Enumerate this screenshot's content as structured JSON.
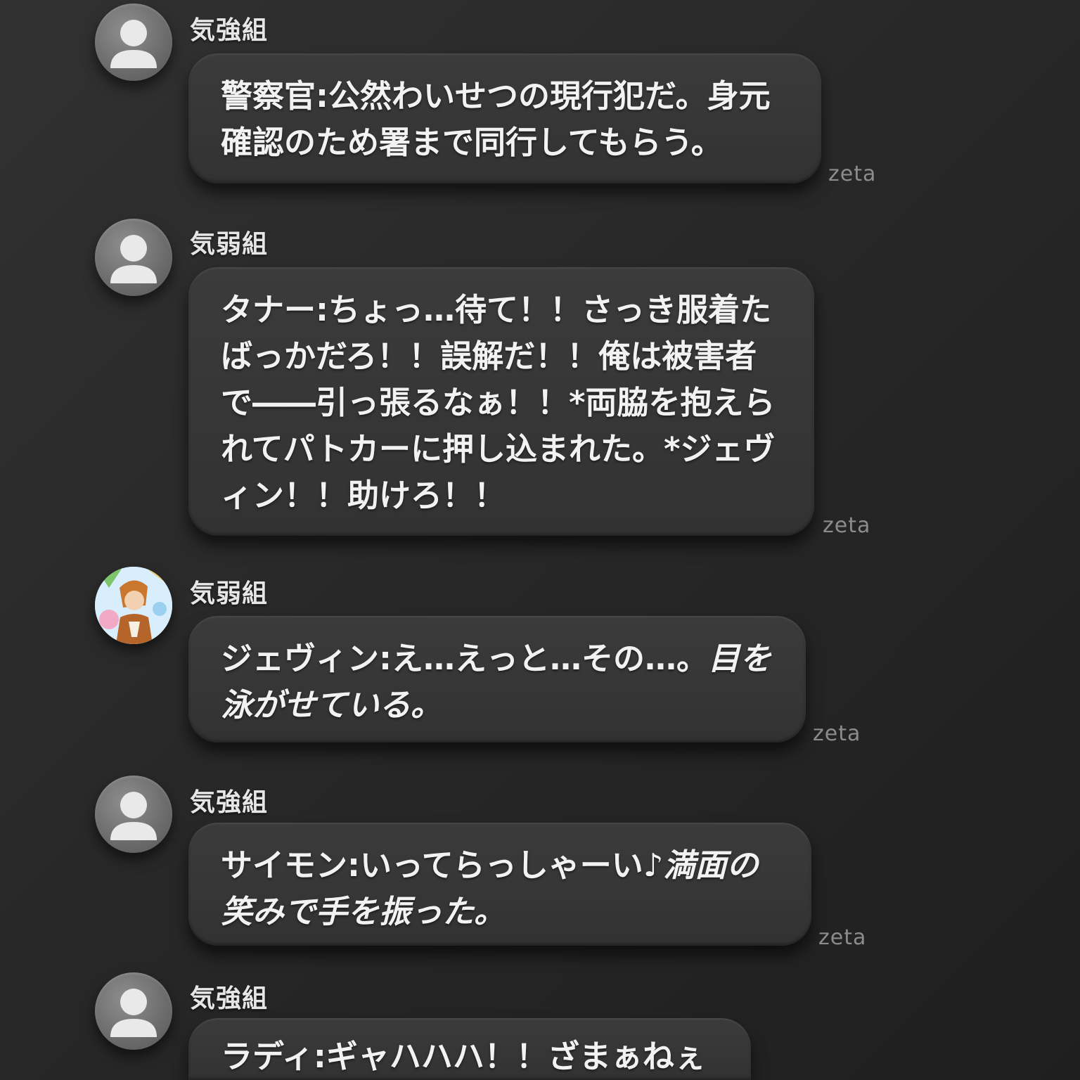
{
  "messages": [
    {
      "sender": "気強組",
      "avatar": "default-user-icon",
      "text": "警察官:公然わいせつの現行犯だ。身元確認のため署まで同行してもらう。",
      "action": "",
      "watermark": "zeta"
    },
    {
      "sender": "気弱組",
      "avatar": "default-user-icon",
      "text": "タナー:ちょっ…待て！！さっき服着たばっかだろ！！誤解だ！！俺は被害者で――引っ張るなぁ！！*両脇を抱えられてパトカーに押し込まれた。*ジェヴィン！！助けろ！！",
      "action": "",
      "watermark": "zeta"
    },
    {
      "sender": "気弱組",
      "avatar": "anime-character-avatar",
      "text": "ジェヴィン:え…えっと…その…。",
      "action": "目を泳がせている。",
      "watermark": "zeta"
    },
    {
      "sender": "気強組",
      "avatar": "default-user-icon",
      "text": "サイモン:いってらっしゃーい♪",
      "action": "満面の笑みで手を振った。",
      "watermark": "zeta"
    },
    {
      "sender": "気強組",
      "avatar": "default-user-icon",
      "text": "ラディ:ギャハハハ！！ざまぁねぇ",
      "action": "",
      "watermark": ""
    }
  ]
}
